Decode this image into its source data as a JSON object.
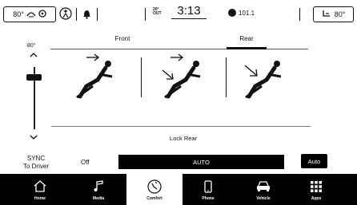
{
  "status_bar": {
    "left_temp": "80°",
    "right_temp": "80°",
    "outside_label_1": "20°",
    "outside_label_2": "OUT",
    "clock": "3:13",
    "radio_station": "101.1"
  },
  "tabs": [
    {
      "label": "Front",
      "active": false
    },
    {
      "label": "Rear",
      "active": true
    }
  ],
  "fan": {
    "label": "80°",
    "level": 0.85
  },
  "airflow_modes": [
    {
      "name": "face"
    },
    {
      "name": "face-and-feet"
    },
    {
      "name": "feet"
    }
  ],
  "lock_rear_label": "Lock Rear",
  "sync": {
    "line1": "SYNC",
    "line2": "To Driver"
  },
  "off_label": "Off",
  "auto_bar_label": "AUTO",
  "auto_button_label": "Auto",
  "nav": [
    {
      "label": "Home",
      "icon": "home-icon"
    },
    {
      "label": "Media",
      "icon": "music-note-icon"
    },
    {
      "label": "Comfort",
      "icon": "comfort-icon",
      "active": true
    },
    {
      "label": "Phone",
      "icon": "phone-icon"
    },
    {
      "label": "Vehicle",
      "icon": "car-icon"
    },
    {
      "label": "Apps",
      "icon": "grid-icon"
    }
  ]
}
